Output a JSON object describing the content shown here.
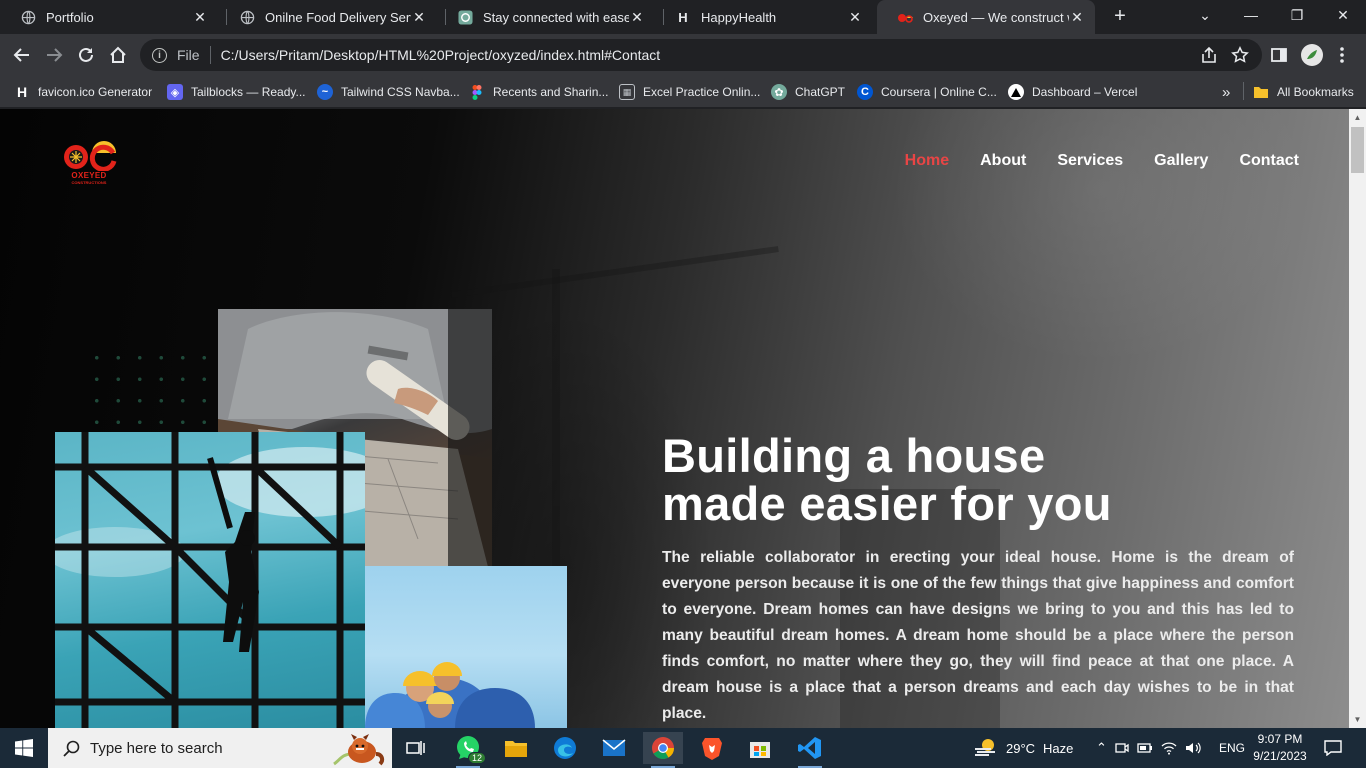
{
  "browser": {
    "tabs": [
      {
        "title": "Portfolio",
        "icon": "globe-icon",
        "active": false
      },
      {
        "title": "Onilne Food Delivery Service",
        "icon": "globe-icon",
        "active": false
      },
      {
        "title": "Stay connected with ease.",
        "icon": "chatgpt-icon",
        "active": false
      },
      {
        "title": "HappyHealth",
        "icon": "h-icon",
        "active": false
      },
      {
        "title": "Oxeyed — We construct with",
        "icon": "oxeyed-icon",
        "active": true
      }
    ],
    "new_tab": "+",
    "address": {
      "security_label": "File",
      "url": "C:/Users/Pritam/Desktop/HTML%20Project/oxyzed/index.html#Contact"
    },
    "bookmarks": [
      {
        "label": "favicon.ico Generator",
        "icon": "h-icon"
      },
      {
        "label": "Tailblocks — Ready...",
        "icon": "tailblocks-icon"
      },
      {
        "label": "Tailwind CSS Navba...",
        "icon": "tailwind-icon"
      },
      {
        "label": "Recents and Sharin...",
        "icon": "figma-icon"
      },
      {
        "label": "Excel Practice Onlin...",
        "icon": "excel-icon"
      },
      {
        "label": "ChatGPT",
        "icon": "chatgpt-icon"
      },
      {
        "label": "Coursera | Online C...",
        "icon": "coursera-icon"
      },
      {
        "label": "Dashboard – Vercel",
        "icon": "vercel-icon"
      }
    ],
    "bookmarks_overflow": "»",
    "all_bookmarks": "All Bookmarks"
  },
  "page": {
    "logo": {
      "line1": "OXEYED",
      "line2": "CONSTRUCTIONS"
    },
    "nav": [
      {
        "label": "Home",
        "active": true
      },
      {
        "label": "About",
        "active": false
      },
      {
        "label": "Services",
        "active": false
      },
      {
        "label": "Gallery",
        "active": false
      },
      {
        "label": "Contact",
        "active": false
      }
    ],
    "hero": {
      "title_line1": "Building a house",
      "title_line2": "made easier for you",
      "text": "The reliable collaborator in erecting your ideal house. Home is the dream of everyone person because it is one of the few things that give happiness and comfort to everyone. Dream homes can have designs we bring to you and this has led to many beautiful dream homes. A dream home should be a place where the person finds comfort, no matter where they go, they will find peace at that one place. A dream house is a place that a person dreams and each day wishes to be in that place."
    },
    "colors": {
      "accent": "#e84545",
      "text": "#ffffff"
    }
  },
  "taskbar": {
    "search_placeholder": "Type here to search",
    "whatsapp_badge": "12",
    "weather": {
      "temp": "29°C",
      "condition": "Haze"
    },
    "language": "ENG",
    "time": "9:07 PM",
    "date": "9/21/2023"
  }
}
